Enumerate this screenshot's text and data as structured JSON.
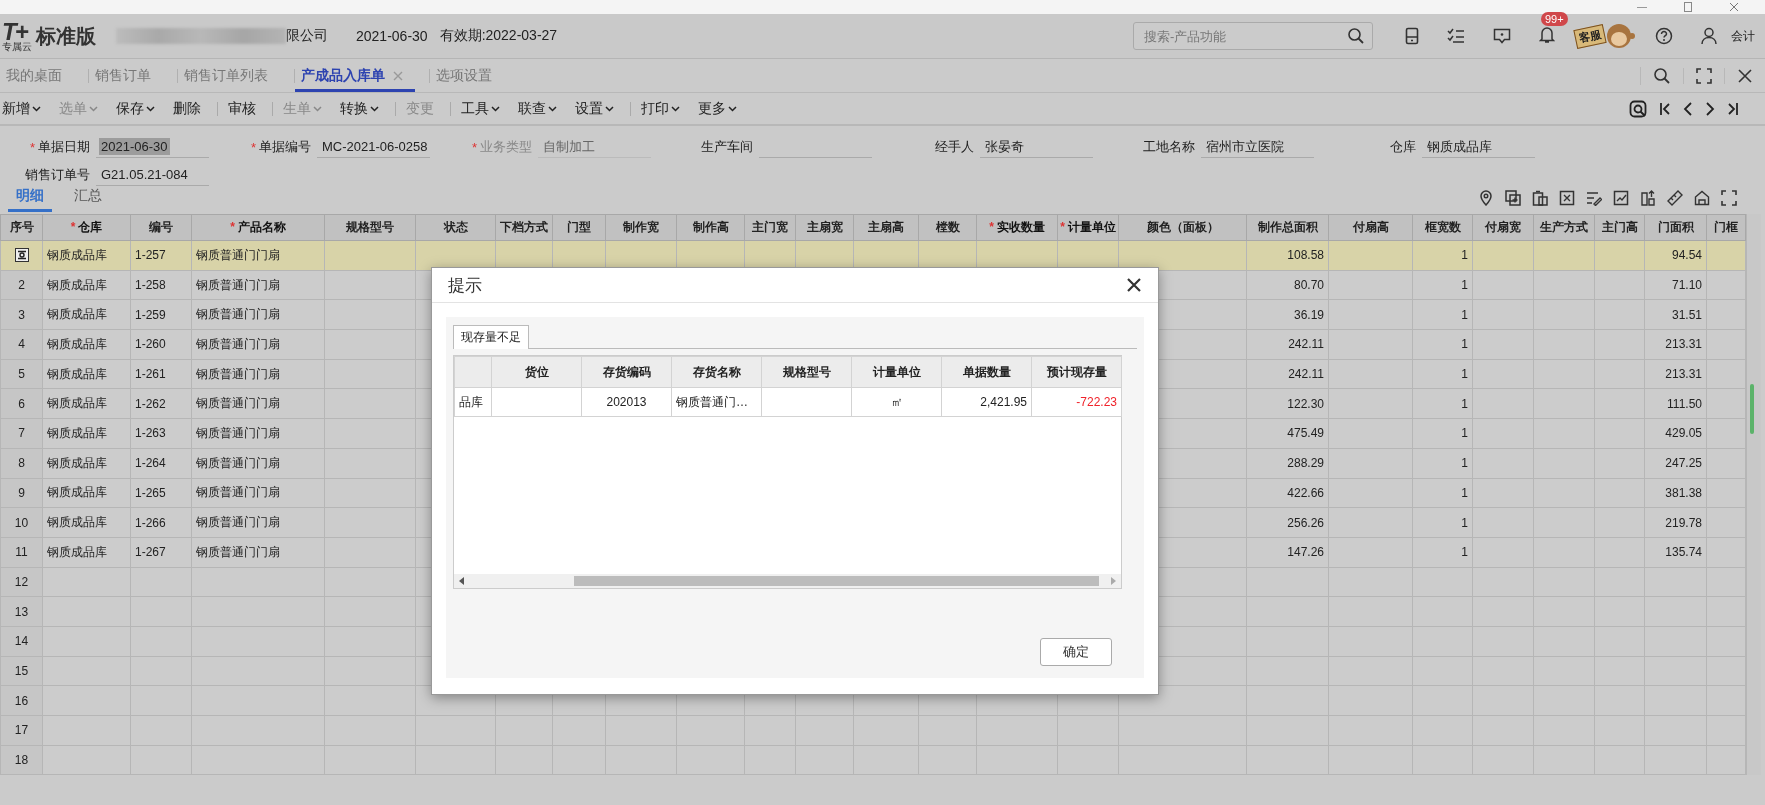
{
  "app_header": {
    "logo_mark": "T+",
    "logo_sub": "专属云",
    "edition": "标准版",
    "company": "限公司",
    "date": "2021-06-30",
    "validity": "有效期:2022-03-27",
    "search": {
      "placeholder": "搜索-产品功能"
    },
    "notification_badge": "99+",
    "support_sign": "客服",
    "user_role": "会计"
  },
  "tabs": [
    {
      "label": "我的桌面",
      "selected": false,
      "closable": false
    },
    {
      "label": "销售订单",
      "selected": false,
      "closable": false
    },
    {
      "label": "销售订单列表",
      "selected": false,
      "closable": false
    },
    {
      "label": "产成品入库单",
      "selected": true,
      "closable": true
    },
    {
      "label": "选项设置",
      "selected": false,
      "closable": false
    }
  ],
  "toolbar": [
    {
      "kind": "button",
      "label": "新增",
      "dropdown": true,
      "disabled": false
    },
    {
      "kind": "button",
      "label": "选单",
      "dropdown": true,
      "disabled": true
    },
    {
      "kind": "button",
      "label": "保存",
      "dropdown": true,
      "disabled": false
    },
    {
      "kind": "button",
      "label": "删除",
      "dropdown": false,
      "disabled": false
    },
    {
      "kind": "separator"
    },
    {
      "kind": "button",
      "label": "审核",
      "dropdown": false,
      "disabled": false
    },
    {
      "kind": "separator"
    },
    {
      "kind": "button",
      "label": "生单",
      "dropdown": true,
      "disabled": true
    },
    {
      "kind": "button",
      "label": "转换",
      "dropdown": true,
      "disabled": false
    },
    {
      "kind": "separator"
    },
    {
      "kind": "button",
      "label": "变更",
      "dropdown": false,
      "disabled": true
    },
    {
      "kind": "separator"
    },
    {
      "kind": "button",
      "label": "工具",
      "dropdown": true,
      "disabled": false
    },
    {
      "kind": "button",
      "label": "联查",
      "dropdown": true,
      "disabled": false
    },
    {
      "kind": "button",
      "label": "设置",
      "dropdown": true,
      "disabled": false
    },
    {
      "kind": "separator"
    },
    {
      "kind": "button",
      "label": "打印",
      "dropdown": true,
      "disabled": false
    },
    {
      "kind": "button",
      "label": "更多",
      "dropdown": true,
      "disabled": false
    }
  ],
  "form": [
    {
      "label": "单据日期",
      "value": "2021-06-30",
      "required_mark": "*",
      "disabled": false,
      "text_selected": true
    },
    {
      "label": "单据编号",
      "value": "MC-2021-06-0258",
      "required_mark": "*",
      "disabled": false,
      "text_selected": false
    },
    {
      "label": "业务类型",
      "value": "自制加工",
      "required_mark": "*",
      "disabled": true,
      "text_selected": false
    },
    {
      "label": "生产车间",
      "disabled": false,
      "text_selected": false
    },
    {
      "label": "经手人",
      "value": "张晏奇",
      "disabled": false,
      "text_selected": false
    },
    {
      "label": "工地名称",
      "value": "宿州市立医院",
      "disabled": false,
      "text_selected": false
    },
    {
      "label": "仓库",
      "value": "钢质成品库",
      "disabled": false,
      "text_selected": false
    },
    {
      "label": "销售订单号",
      "value": "G21.05.21-084",
      "disabled": false,
      "text_selected": false
    }
  ],
  "detail_tabs": [
    {
      "label": "明细",
      "selected": true
    },
    {
      "label": "汇总",
      "selected": false
    }
  ],
  "table": {
    "columns": [
      {
        "label": "序号",
        "required": false
      },
      {
        "label": "仓库",
        "required": true,
        "required_mark": "*"
      },
      {
        "label": "编号",
        "required": false
      },
      {
        "label": "产品名称",
        "required": true,
        "required_mark": "*"
      },
      {
        "label": "规格型号",
        "required": false
      },
      {
        "label": "状态",
        "required": false
      },
      {
        "label": "下档方式",
        "required": false
      },
      {
        "label": "门型",
        "required": false
      },
      {
        "label": "制作宽",
        "required": false
      },
      {
        "label": "制作高",
        "required": false
      },
      {
        "label": "主门宽",
        "required": false
      },
      {
        "label": "主扇宽",
        "required": false
      },
      {
        "label": "主扇高",
        "required": false
      },
      {
        "label": "樘数",
        "required": false
      },
      {
        "label": "实收数量",
        "required": true,
        "required_mark": "*"
      },
      {
        "label": "计量单位",
        "required": true,
        "required_mark": "*"
      },
      {
        "label": "颜色（面板）",
        "required": false
      },
      {
        "label": "制作总面积",
        "required": false
      },
      {
        "label": "付扇高",
        "required": false
      },
      {
        "label": "框宽数",
        "required": false
      },
      {
        "label": "付扇宽",
        "required": false
      },
      {
        "label": "生产方式",
        "required": false
      },
      {
        "label": "主门高",
        "required": false
      },
      {
        "label": "门面积",
        "required": false
      },
      {
        "label": "门框",
        "required": false
      }
    ],
    "rows": [
      {
        "selected": true,
        "warehouse": "钢质成品库",
        "code": "1-257",
        "product": "钢质普通门门扇",
        "total_area": "108.58",
        "frame_count": "1",
        "door_area": "94.54"
      },
      {
        "no": "2",
        "selected": false,
        "warehouse": "钢质成品库",
        "code": "1-258",
        "product": "钢质普通门门扇",
        "total_area": "80.70",
        "frame_count": "1",
        "door_area": "71.10"
      },
      {
        "no": "3",
        "selected": false,
        "warehouse": "钢质成品库",
        "code": "1-259",
        "product": "钢质普通门门扇",
        "total_area": "36.19",
        "frame_count": "1",
        "door_area": "31.51"
      },
      {
        "no": "4",
        "selected": false,
        "warehouse": "钢质成品库",
        "code": "1-260",
        "product": "钢质普通门门扇",
        "total_area": "242.11",
        "frame_count": "1",
        "door_area": "213.31"
      },
      {
        "no": "5",
        "selected": false,
        "warehouse": "钢质成品库",
        "code": "1-261",
        "product": "钢质普通门门扇",
        "total_area": "242.11",
        "frame_count": "1",
        "door_area": "213.31"
      },
      {
        "no": "6",
        "selected": false,
        "warehouse": "钢质成品库",
        "code": "1-262",
        "product": "钢质普通门门扇",
        "total_area": "122.30",
        "frame_count": "1",
        "door_area": "111.50"
      },
      {
        "no": "7",
        "selected": false,
        "warehouse": "钢质成品库",
        "code": "1-263",
        "product": "钢质普通门门扇",
        "total_area": "475.49",
        "frame_count": "1",
        "door_area": "429.05"
      },
      {
        "no": "8",
        "selected": false,
        "warehouse": "钢质成品库",
        "code": "1-264",
        "product": "钢质普通门门扇",
        "total_area": "288.29",
        "frame_count": "1",
        "door_area": "247.25"
      },
      {
        "no": "9",
        "selected": false,
        "warehouse": "钢质成品库",
        "code": "1-265",
        "product": "钢质普通门门扇",
        "total_area": "422.66",
        "frame_count": "1",
        "door_area": "381.38"
      },
      {
        "no": "10",
        "selected": false,
        "warehouse": "钢质成品库",
        "code": "1-266",
        "product": "钢质普通门门扇",
        "total_area": "256.26",
        "frame_count": "1",
        "door_area": "219.78"
      },
      {
        "no": "11",
        "selected": false,
        "warehouse": "钢质成品库",
        "code": "1-267",
        "product": "钢质普通门门扇",
        "total_area": "147.26",
        "frame_count": "1",
        "door_area": "135.74"
      },
      {
        "no": "12",
        "selected": false
      },
      {
        "no": "13",
        "selected": false
      },
      {
        "no": "14",
        "selected": false
      },
      {
        "no": "15",
        "selected": false
      },
      {
        "no": "16",
        "selected": false
      },
      {
        "no": "17",
        "selected": false
      },
      {
        "no": "18",
        "selected": false
      }
    ]
  },
  "dialog": {
    "title": "提示",
    "tab": "现存量不足",
    "columns": [
      {},
      {
        "label": "货位"
      },
      {
        "label": "存货编码"
      },
      {
        "label": "存货名称"
      },
      {
        "label": "规格型号"
      },
      {
        "label": "计量单位"
      },
      {
        "label": "单据数量"
      },
      {
        "label": "预计现存量"
      }
    ],
    "rows": [
      {
        "cells": [
          {
            "text": "品库",
            "negative": false
          },
          {},
          {
            "text": "202013",
            "negative": false
          },
          {
            "text": "钢质普通门…",
            "negative": false
          },
          {},
          {
            "text": "㎡",
            "negative": false
          },
          {
            "text": "2,421.95",
            "negative": false
          },
          {
            "text": "-722.23",
            "negative": true
          }
        ]
      }
    ],
    "ok_button": "确定"
  }
}
